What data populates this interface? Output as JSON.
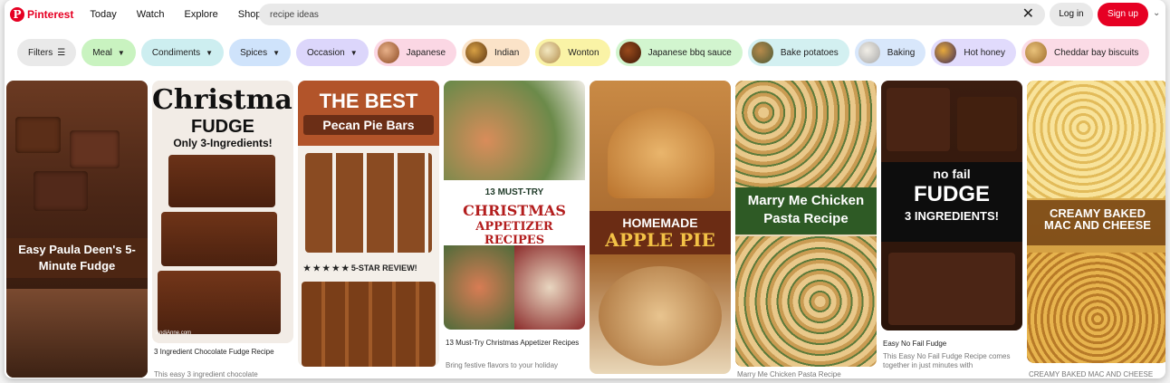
{
  "brand": {
    "name": "Pinterest"
  },
  "nav": [
    "Today",
    "Watch",
    "Explore",
    "Shop"
  ],
  "search": {
    "value": "recipe ideas",
    "clear_icon": "close-icon"
  },
  "auth": {
    "login": "Log in",
    "signup": "Sign up"
  },
  "chips": [
    {
      "label": "Filters",
      "icon": "sliders-icon",
      "bg": "#e9e9e9"
    },
    {
      "label": "Meal",
      "caret": true,
      "bg": "#c9f3c0"
    },
    {
      "label": "Condiments",
      "caret": true,
      "bg": "#cdeef0"
    },
    {
      "label": "Spices",
      "caret": true,
      "bg": "#cfe3fb"
    },
    {
      "label": "Occasion",
      "caret": true,
      "bg": "#dcd6fb"
    },
    {
      "label": "Japanese",
      "thumb": true,
      "bg": "#fbd7e4"
    },
    {
      "label": "Indian",
      "thumb": true,
      "bg": "#fbe3c8"
    },
    {
      "label": "Wonton",
      "thumb": true,
      "bg": "#faf3a6"
    },
    {
      "label": "Japanese bbq sauce",
      "thumb": true,
      "bg": "#d2f5cf"
    },
    {
      "label": "Bake potatoes",
      "thumb": true,
      "bg": "#d3f0f1"
    },
    {
      "label": "Baking",
      "thumb": true,
      "bg": "#d8e7fb"
    },
    {
      "label": "Hot honey",
      "thumb": true,
      "bg": "#e1dbfc"
    },
    {
      "label": "Cheddar bay biscuits",
      "thumb": true,
      "bg": "#fbdbe6"
    }
  ],
  "pins": [
    {
      "overlay": "Easy Paula Deen's 5-Minute Fudge"
    },
    {
      "overlay_1": "Christmas",
      "overlay_2": "FUDGE",
      "overlay_3": "Only 3-Ingredients!",
      "credit": "AndiAnne.com",
      "title": "3 Ingredient Chocolate Fudge Recipe",
      "desc": "This easy 3 ingredient chocolate"
    },
    {
      "overlay_1": "THE BEST",
      "overlay_2": "Pecan Pie Bars",
      "stars": "★ ★ ★ ★ ★ 5-STAR REVIEW!"
    },
    {
      "overlay_1": "13 MUST-TRY",
      "overlay_2": "CHRISTMAS",
      "overlay_3": "APPETIZER RECIPES",
      "title": "13 Must-Try Christmas Appetizer Recipes",
      "desc": "Bring festive flavors to your holiday"
    },
    {
      "overlay_1": "HOMEMADE",
      "overlay_2": "APPLE PIE"
    },
    {
      "overlay_1": "Marry Me Chicken",
      "overlay_2": "Pasta Recipe",
      "title": "Marry Me Chicken Pasta Recipe"
    },
    {
      "overlay_1": "no fail",
      "overlay_2": "FUDGE",
      "overlay_3": "3 INGREDIENTS!",
      "title": "Easy No Fail Fudge",
      "desc": "This Easy No Fail Fudge Recipe comes together in just minutes with"
    },
    {
      "overlay_1": "CREAMY BAKED",
      "overlay_2": "MAC AND CHEESE",
      "title": "CREAMY BAKED MAC AND CHEESE"
    }
  ],
  "colors": {
    "brand": "#e60023"
  }
}
